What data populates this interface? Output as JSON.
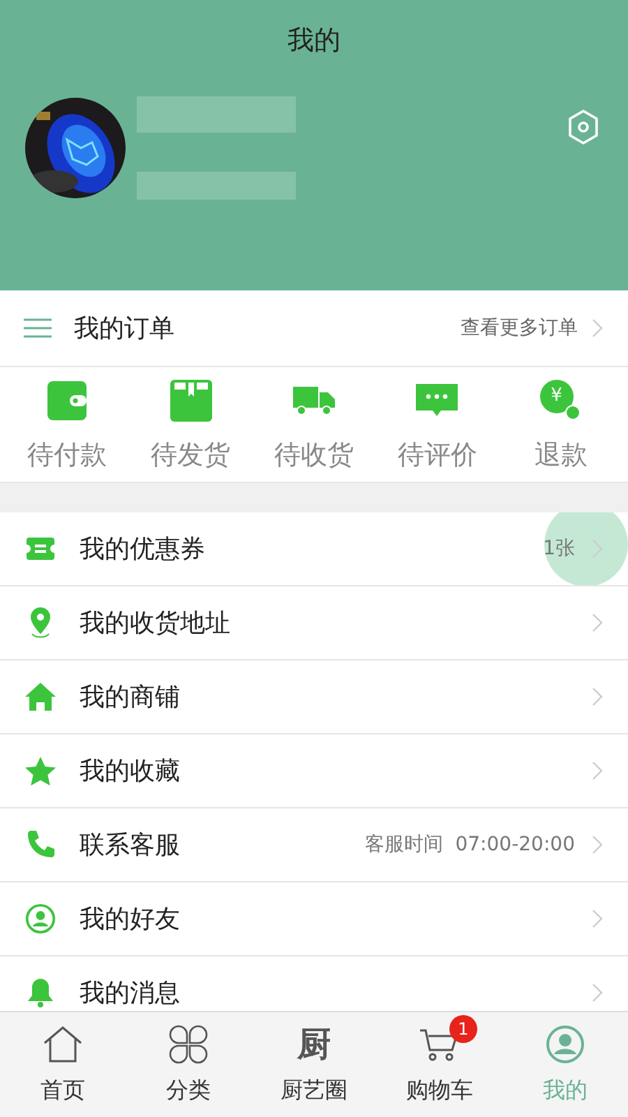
{
  "header": {
    "title": "我的"
  },
  "orders": {
    "title": "我的订单",
    "more": "查看更多订单",
    "statuses": [
      {
        "kind": "wallet",
        "label": "待付款"
      },
      {
        "kind": "box",
        "label": "待发货"
      },
      {
        "kind": "truck",
        "label": "待收货"
      },
      {
        "kind": "chat",
        "label": "待评价"
      },
      {
        "kind": "refund",
        "label": "退款",
        "glyph": "¥"
      }
    ]
  },
  "menu": [
    {
      "kind": "coupon",
      "label": "我的优惠券",
      "detail": "1张",
      "pressed": true
    },
    {
      "kind": "pin",
      "label": "我的收货地址",
      "pressed": false
    },
    {
      "kind": "home",
      "label": "我的商铺",
      "pressed": false
    },
    {
      "kind": "star",
      "label": "我的收藏",
      "pressed": false
    },
    {
      "kind": "phone",
      "label": "联系客服",
      "detail": "客服时间  07:00-20:00",
      "pressed": false
    },
    {
      "kind": "friend",
      "label": "我的好友",
      "pressed": false
    },
    {
      "kind": "bell",
      "label": "我的消息",
      "pressed": false
    }
  ],
  "tabbar": [
    {
      "kind": "home",
      "label": "首页",
      "selected": false
    },
    {
      "kind": "grid",
      "label": "分类",
      "selected": false
    },
    {
      "kind": "glyph",
      "glyph": "厨",
      "label": "厨艺圈",
      "selected": false
    },
    {
      "kind": "cart",
      "label": "购物车",
      "badge": "1",
      "selected": false
    },
    {
      "kind": "user",
      "label": "我的",
      "selected": true
    }
  ]
}
